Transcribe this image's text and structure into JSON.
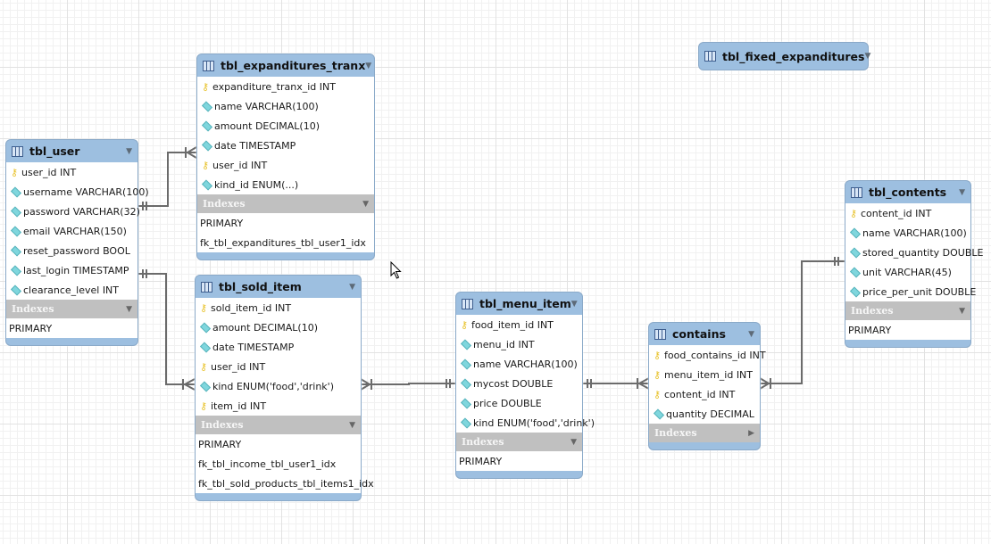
{
  "diagram": {
    "type": "EER diagram",
    "tables": [
      {
        "id": "tbl_user",
        "name": "tbl_user",
        "columns": [
          {
            "icon": "key-icon",
            "text": "user_id INT"
          },
          {
            "icon": "attribute-icon",
            "text": "username VARCHAR(100)"
          },
          {
            "icon": "attribute-icon",
            "text": "password VARCHAR(32)"
          },
          {
            "icon": "attribute-icon",
            "text": "email VARCHAR(150)"
          },
          {
            "icon": "attribute-icon",
            "text": "reset_password BOOL"
          },
          {
            "icon": "attribute-icon",
            "text": "last_login TIMESTAMP"
          },
          {
            "icon": "attribute-icon",
            "text": "clearance_level INT"
          }
        ],
        "indexes_label": "Indexes",
        "indexes": [
          "PRIMARY"
        ]
      },
      {
        "id": "tbl_expanditures_tranx",
        "name": "tbl_expanditures_tranx",
        "columns": [
          {
            "icon": "key-icon",
            "text": "expanditure_tranx_id INT"
          },
          {
            "icon": "attribute-icon",
            "text": "name VARCHAR(100)"
          },
          {
            "icon": "attribute-icon",
            "text": "amount DECIMAL(10)"
          },
          {
            "icon": "attribute-icon",
            "text": "date TIMESTAMP"
          },
          {
            "icon": "key-icon",
            "text": "user_id INT"
          },
          {
            "icon": "attribute-icon",
            "text": "kind_id ENUM(...)"
          }
        ],
        "indexes_label": "Indexes",
        "indexes": [
          "PRIMARY",
          "fk_tbl_expanditures_tbl_user1_idx"
        ]
      },
      {
        "id": "tbl_sold_item",
        "name": "tbl_sold_item",
        "columns": [
          {
            "icon": "key-icon",
            "text": "sold_item_id INT"
          },
          {
            "icon": "attribute-icon",
            "text": "amount DECIMAL(10)"
          },
          {
            "icon": "attribute-icon",
            "text": "date TIMESTAMP"
          },
          {
            "icon": "key-icon",
            "text": "user_id INT"
          },
          {
            "icon": "attribute-icon",
            "text": "kind ENUM('food','drink')"
          },
          {
            "icon": "key-icon",
            "text": "item_id INT"
          }
        ],
        "indexes_label": "Indexes",
        "indexes": [
          "PRIMARY",
          "fk_tbl_income_tbl_user1_idx",
          "fk_tbl_sold_products_tbl_items1_idx"
        ]
      },
      {
        "id": "tbl_menu_item",
        "name": "tbl_menu_item",
        "columns": [
          {
            "icon": "key-icon",
            "text": "food_item_id INT"
          },
          {
            "icon": "attribute-icon",
            "text": "menu_id INT"
          },
          {
            "icon": "attribute-icon",
            "text": "name VARCHAR(100)"
          },
          {
            "icon": "attribute-icon",
            "text": "mycost DOUBLE"
          },
          {
            "icon": "attribute-icon",
            "text": "price DOUBLE"
          },
          {
            "icon": "attribute-icon",
            "text": "kind ENUM('food','drink')"
          }
        ],
        "indexes_label": "Indexes",
        "indexes": [
          "PRIMARY"
        ]
      },
      {
        "id": "contains",
        "name": "contains",
        "columns": [
          {
            "icon": "key-icon",
            "text": "food_contains_id INT"
          },
          {
            "icon": "key-icon",
            "text": "menu_item_id INT"
          },
          {
            "icon": "key-icon",
            "text": "content_id INT"
          },
          {
            "icon": "attribute-icon",
            "text": "quantity DECIMAL"
          }
        ],
        "indexes_label": "Indexes",
        "indexes_collapsed": true,
        "indexes": []
      },
      {
        "id": "tbl_contents",
        "name": "tbl_contents",
        "columns": [
          {
            "icon": "key-icon",
            "text": "content_id INT"
          },
          {
            "icon": "attribute-icon",
            "text": "name VARCHAR(100)"
          },
          {
            "icon": "attribute-icon",
            "text": "stored_quantity DOUBLE"
          },
          {
            "icon": "attribute-icon",
            "text": "unit VARCHAR(45)"
          },
          {
            "icon": "attribute-icon",
            "text": "price_per_unit DOUBLE"
          }
        ],
        "indexes_label": "Indexes",
        "indexes": [
          "PRIMARY"
        ]
      },
      {
        "id": "tbl_fixed_expanditures",
        "name": "tbl_fixed_expanditures",
        "collapsed": true,
        "columns": [],
        "indexes": []
      }
    ],
    "relationships": [
      {
        "from": "tbl_user",
        "to": "tbl_expanditures_tranx",
        "type": "one-to-many"
      },
      {
        "from": "tbl_user",
        "to": "tbl_sold_item",
        "type": "one-to-many"
      },
      {
        "from": "tbl_menu_item",
        "to": "tbl_sold_item",
        "type": "one-to-many"
      },
      {
        "from": "tbl_menu_item",
        "to": "contains",
        "type": "one-to-many"
      },
      {
        "from": "tbl_contents",
        "to": "contains",
        "type": "one-to-many"
      }
    ],
    "icons": {
      "table": "table-icon",
      "key": "key-icon",
      "attribute": "attribute-icon",
      "caret_down": "▼",
      "caret_right": "▶",
      "key_glyph": "⚷"
    }
  }
}
